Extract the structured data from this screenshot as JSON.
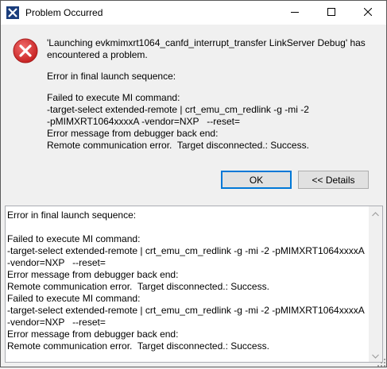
{
  "window": {
    "title": "Problem Occurred"
  },
  "icons": {
    "app": "eclipse-x-icon",
    "error": "error-icon",
    "minimize": "minimize-icon",
    "maximize": "maximize-icon",
    "close": "close-icon"
  },
  "colors": {
    "error_red": "#d12c2c",
    "app_icon_blue": "#1a3d7c",
    "focus_border": "#0078d7"
  },
  "message": {
    "title_line1": "'Launching evkmimxrt1064_canfd_interrupt_transfer LinkServer Debug' has",
    "title_line2": "encountered a problem.",
    "detail": "Error in final launch sequence:",
    "failed_block": "Failed to execute MI command:\n-target-select extended-remote | crt_emu_cm_redlink -g -mi -2\n-pMIMXRT1064xxxxA -vendor=NXP   --reset=\nError message from debugger back end:\nRemote communication error.  Target disconnected.: Success."
  },
  "buttons": {
    "ok": "OK",
    "details": "<< Details"
  },
  "details": {
    "text": "Error in final launch sequence:\n\nFailed to execute MI command:\n-target-select extended-remote | crt_emu_cm_redlink -g -mi -2 -pMIMXRT1064xxxxA\n-vendor=NXP   --reset=\nError message from debugger back end:\nRemote communication error.  Target disconnected.: Success.\nFailed to execute MI command:\n-target-select extended-remote | crt_emu_cm_redlink -g -mi -2 -pMIMXRT1064xxxxA\n-vendor=NXP   --reset=\nError message from debugger back end:\nRemote communication error.  Target disconnected.: Success."
  }
}
